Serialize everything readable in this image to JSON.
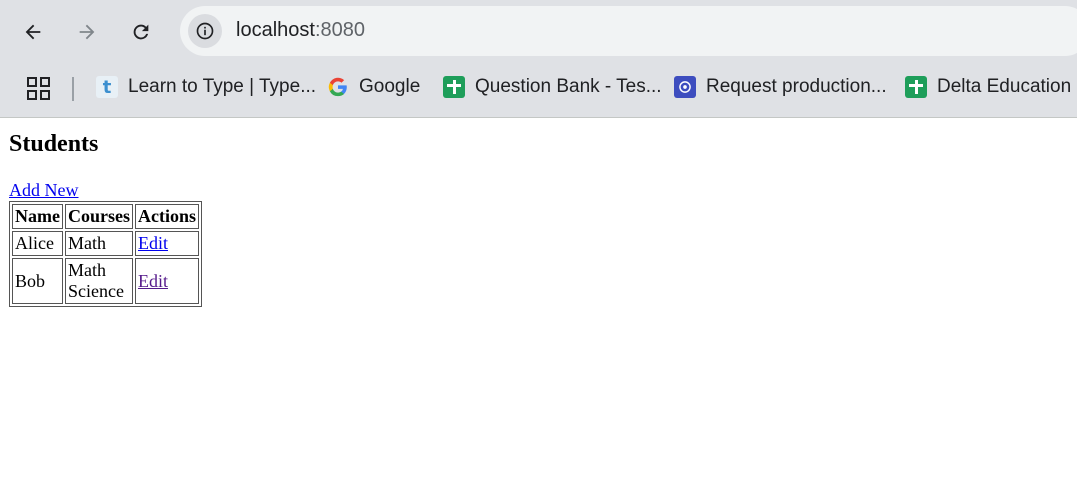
{
  "browser": {
    "url_host": "localhost",
    "url_port": ":8080",
    "bookmarks": [
      {
        "label": "Learn to Type | Type...",
        "icon": "typing-t-icon"
      },
      {
        "label": "Google",
        "icon": "google-icon"
      },
      {
        "label": "Question Bank - Tes...",
        "icon": "sheets-icon"
      },
      {
        "label": "Request production...",
        "icon": "request-icon"
      },
      {
        "label": "Delta Education B",
        "icon": "sheets-icon"
      }
    ],
    "colors": {
      "chrome_bg": "#dfe1e5",
      "omnibox_bg": "#f1f3f4",
      "link": "#0000ee",
      "visited_link": "#551a8b"
    }
  },
  "page": {
    "title": "Students",
    "add_new_label": "Add New",
    "table": {
      "headers": [
        "Name",
        "Courses",
        "Actions"
      ],
      "rows": [
        {
          "name": "Alice",
          "courses": [
            "Math"
          ],
          "action": "Edit"
        },
        {
          "name": "Bob",
          "courses": [
            "Math",
            "Science"
          ],
          "action": "Edit"
        }
      ]
    }
  }
}
